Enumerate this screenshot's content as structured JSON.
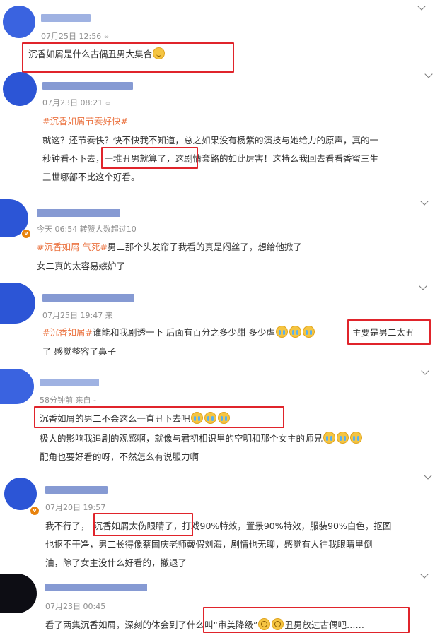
{
  "posts": [
    {
      "meta": "07月25日 12:56",
      "lines": [
        "沉香如屑是什么古偶丑男大集合"
      ]
    },
    {
      "meta": "07月23日 08:21",
      "tag": "#沉香如屑节奏好快#",
      "lines": [
        "就这？还节奏快？快不快我不知道，总之如果没有杨紫的演技与她给力的原声，真的一",
        "秒钟看不下去，一堆丑男就算了，这剧情套路的如此厉害！这特么我回去看看香蜜三生",
        "三世哪部不比这个好看。"
      ]
    },
    {
      "meta": "今天 06:54 转赞人数超过10",
      "tag": "#沉香如屑 气死#",
      "lines": [
        "男二那个头发帘子我看的真是闷丝了，想给他掀了",
        "女二真的太容易嫉妒了"
      ]
    },
    {
      "meta": "07月25日 19:47 来",
      "tag": "#沉香如屑#",
      "lines": [
        "谁能和我剧透一下 后面有百分之多少甜 多少虐",
        "主要是男二太丑",
        "了 感觉整容了鼻子"
      ]
    },
    {
      "meta": "58分钟前 来自 -",
      "lines": [
        "沉香如屑的男二不会这么一直丑下去吧",
        "极大的影响我追剧的观感啊，就像与君初相识里的空明和那个女主的师兄",
        "配角也要好看的呀，不然怎么有说服力啊"
      ]
    },
    {
      "meta": "07月20日 19:57",
      "lines": [
        "我不行了，",
        "沉香如屑太伤眼睛了",
        "，打戏90%特效，置景90%特效，服装90%白色，抠图",
        "也抠不干净，男二长得像蔡国庆老师戴假刘海，剧情也无聊，感觉有人往我眼睛里倒",
        "油，除了女主没什么好看的，撤退了"
      ]
    },
    {
      "meta": "07月23日 00:45",
      "lines": [
        "看了两集沉香如屑，深刻的体会到了",
        "什么叫“审美降级”",
        "丑男放过古偶吧……"
      ]
    }
  ],
  "icons": {
    "collapse": "chevron-down-icon",
    "verified": "v-badge-icon",
    "emoji_smile": "smile-emoji-icon",
    "emoji_cry": "crying-emoji-icon",
    "emoji_dizzy": "dizzy-emoji-icon"
  },
  "colors": {
    "tag": "#eb7340",
    "highlight_box": "#e0242b",
    "avatar": "#2c55d6",
    "meta": "#8f8f8f"
  }
}
